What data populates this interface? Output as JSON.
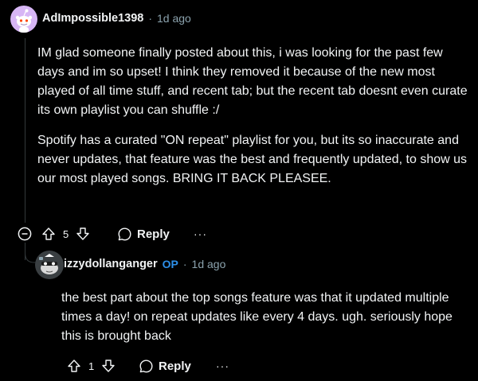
{
  "comment": {
    "author": "AdImpossible1398",
    "separator": "·",
    "age": "1d ago",
    "paragraphs": [
      "IM glad someone finally posted about this, i was looking for the past few days and im so upset! I think they removed it because of the new most played of all time stuff, and recent tab; but the recent tab doesnt even curate its own playlist you can shuffle :/",
      "Spotify has a curated \"ON repeat\" playlist for you, but its so inaccurate and never updates, that feature was the best and frequently updated, to show us our most played songs. BRING IT BACK PLEASEE."
    ],
    "vote_count": "5",
    "reply_label": "Reply",
    "more_label": "···"
  },
  "reply": {
    "author": "izzydollanganger",
    "op_badge": "OP",
    "separator": "·",
    "age": "1d ago",
    "text": "the best part about the top songs feature was that it updated multiple times a day! on repeat updates like every 4 days. ugh. seriously hope this is brought back",
    "vote_count": "1",
    "reply_label": "Reply",
    "more_label": "···"
  },
  "colors": {
    "background": "#000000",
    "text": "#f2f4f5",
    "meta": "#8ba2ad",
    "op_badge": "#2d8fe8",
    "avatar_bg": "#d7b6f5"
  },
  "icons": [
    "snoo-avatar-icon",
    "collapse-minus-icon",
    "upvote-arrow-icon",
    "downvote-arrow-icon",
    "reply-bubble-icon",
    "more-dots-icon"
  ]
}
